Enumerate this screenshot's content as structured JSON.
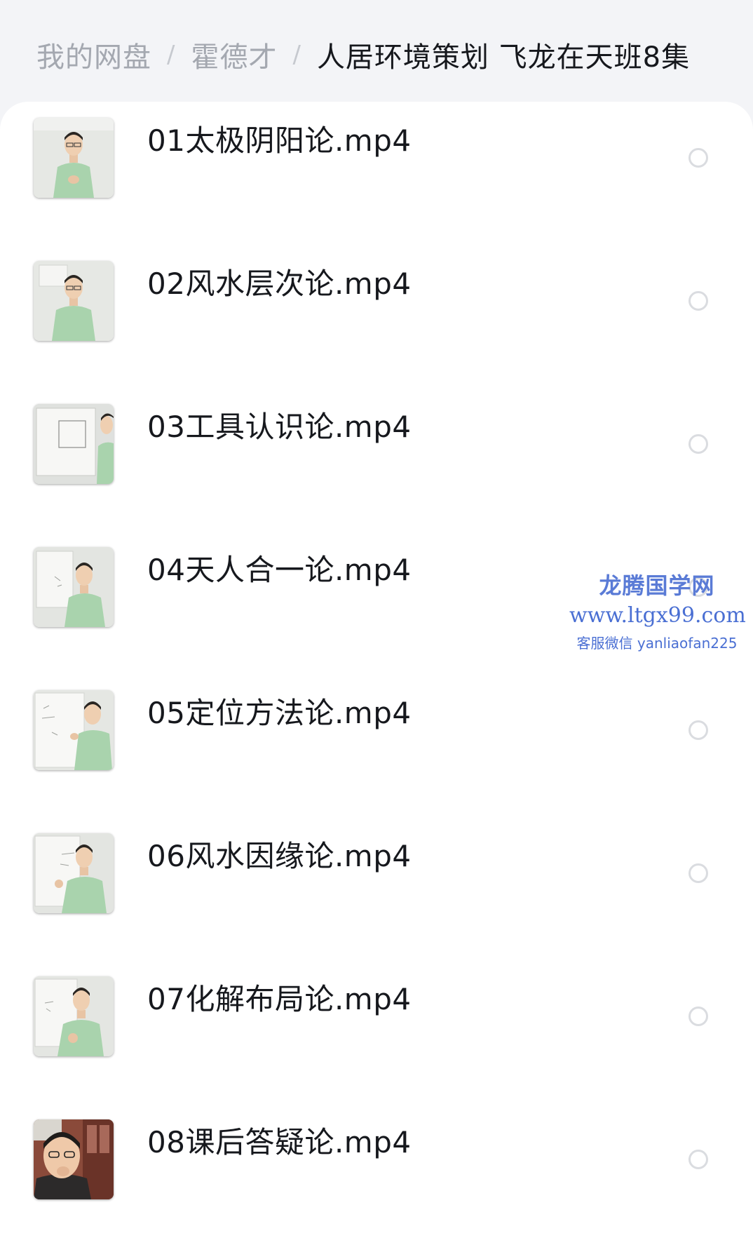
{
  "breadcrumb": {
    "items": [
      "我的网盘",
      "霍德才",
      "人居环境策划 飞龙在天班8集"
    ],
    "separator": "/"
  },
  "files": [
    {
      "name": "01太极阴阳论.mp4",
      "thumbnail": "lecturer-standing"
    },
    {
      "name": "02风水层次论.mp4",
      "thumbnail": "lecturer-standing"
    },
    {
      "name": "03工具认识论.mp4",
      "thumbnail": "whiteboard-diagram"
    },
    {
      "name": "04天人合一论.mp4",
      "thumbnail": "lecturer-whiteboard"
    },
    {
      "name": "05定位方法论.mp4",
      "thumbnail": "lecturer-writing"
    },
    {
      "name": "06风水因缘论.mp4",
      "thumbnail": "lecturer-pointing"
    },
    {
      "name": "07化解布局论.mp4",
      "thumbnail": "lecturer-gesturing"
    },
    {
      "name": "08课后答疑论.mp4",
      "thumbnail": "closeup-indoor"
    }
  ],
  "watermark": {
    "title": "龙腾国学网",
    "url": "www.ltgx99.com",
    "contact": "客服微信 yanliaofan225"
  },
  "colors": {
    "page_background": "#f3f4f7",
    "panel_background": "#ffffff",
    "breadcrumb_inactive": "#a4a8b0",
    "breadcrumb_active": "#16181d",
    "file_name_text": "#16181d",
    "radio_border": "#dadce0",
    "watermark_blue": "#4a6fd3",
    "shirt_green": "#a9d3ad"
  }
}
